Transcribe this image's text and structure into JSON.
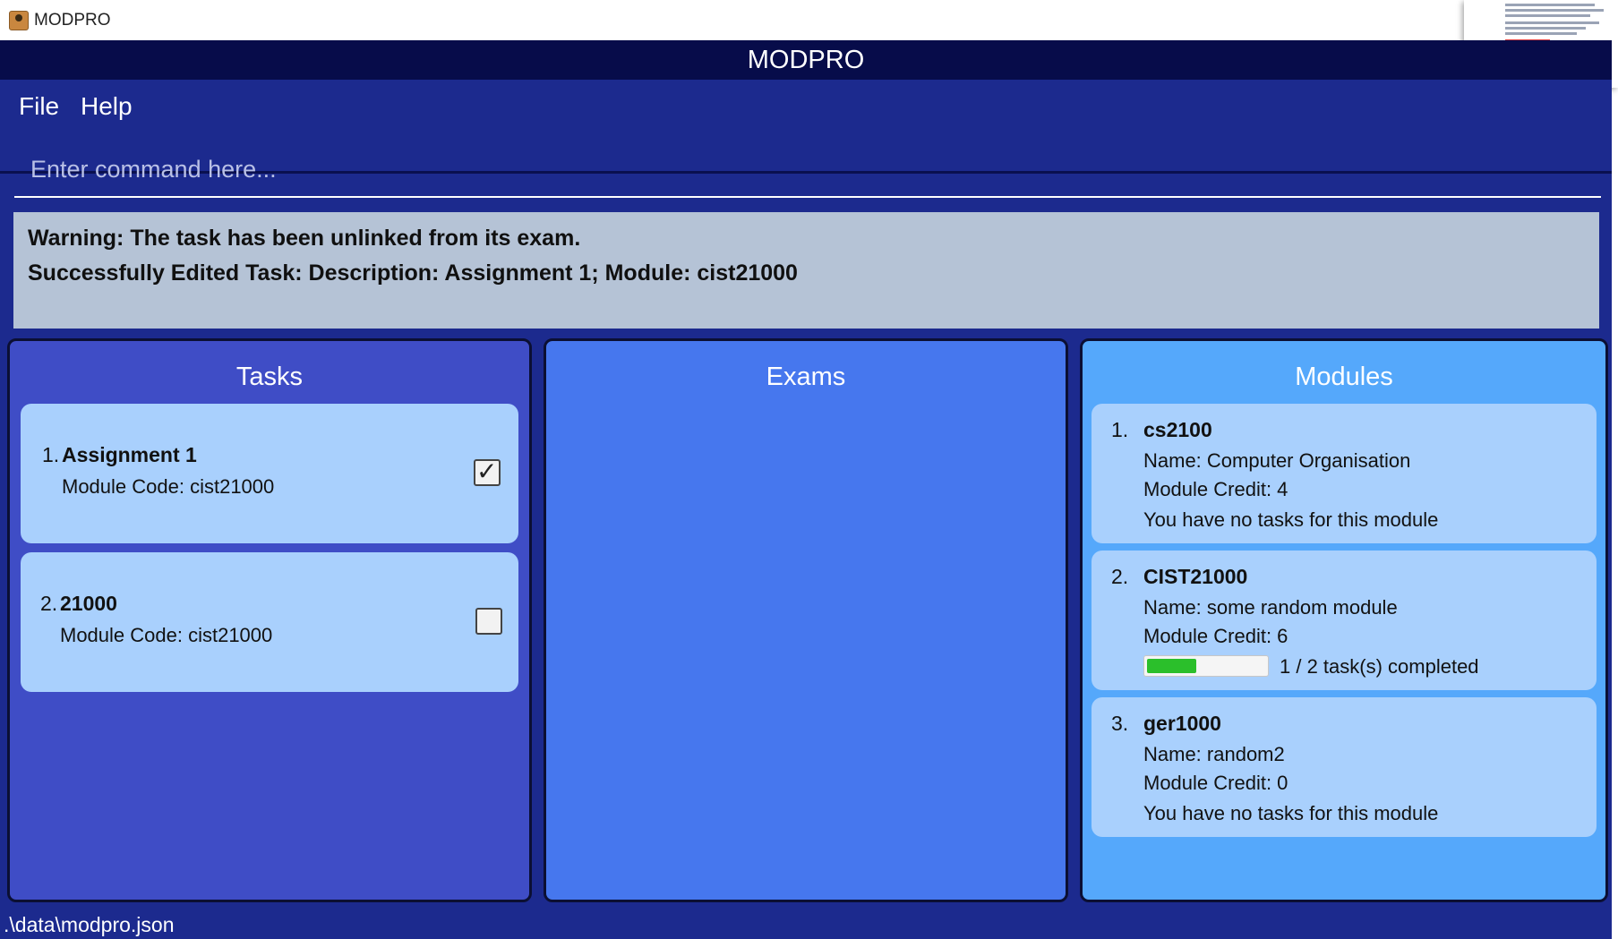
{
  "window": {
    "title": "MODPRO",
    "app_icon": "modpro-app-icon"
  },
  "app": {
    "header_title": "MODPRO"
  },
  "menu": {
    "file_label": "File",
    "help_label": "Help"
  },
  "command": {
    "placeholder": "Enter command here...",
    "value": ""
  },
  "result": {
    "lines": [
      "Warning: The task has been unlinked from its exam.",
      "Successfully Edited Task: Description: Assignment 1; Module: cist21000"
    ]
  },
  "tasks_panel": {
    "title": "Tasks",
    "items": [
      {
        "index": "1.",
        "description": "Assignment 1",
        "module_line": "Module Code: cist21000",
        "done": true
      },
      {
        "index": "2.",
        "description": "21000",
        "module_line": "Module Code: cist21000",
        "done": false
      }
    ]
  },
  "exams_panel": {
    "title": "Exams",
    "items": []
  },
  "modules_panel": {
    "title": "Modules",
    "items": [
      {
        "index": "1.",
        "code": "cs2100",
        "name_line": "Name: Computer Organisation",
        "credit_line": "Module Credit: 4",
        "status_line": "You have no tasks for this module"
      },
      {
        "index": "2.",
        "code": "CIST21000",
        "name_line": "Name: some random module",
        "credit_line": "Module Credit: 6",
        "progress_fraction": 0.5,
        "progress_text": "1 / 2 task(s) completed"
      },
      {
        "index": "3.",
        "code": "ger1000",
        "name_line": "Name: random2",
        "credit_line": "Module Credit: 0",
        "status_line": "You have no tasks for this module"
      }
    ]
  },
  "status_bar": {
    "path": ".\\data\\modpro.json"
  },
  "colors": {
    "header": "#070c4a",
    "app_bg": "#1c2a8e",
    "tasks_panel": "#3f4dc6",
    "exams_panel": "#4677ee",
    "modules_panel": "#55a8fb",
    "card": "#a9d0fd",
    "result_box": "#b5c3d6",
    "progress_fill": "#2bbf2b"
  }
}
